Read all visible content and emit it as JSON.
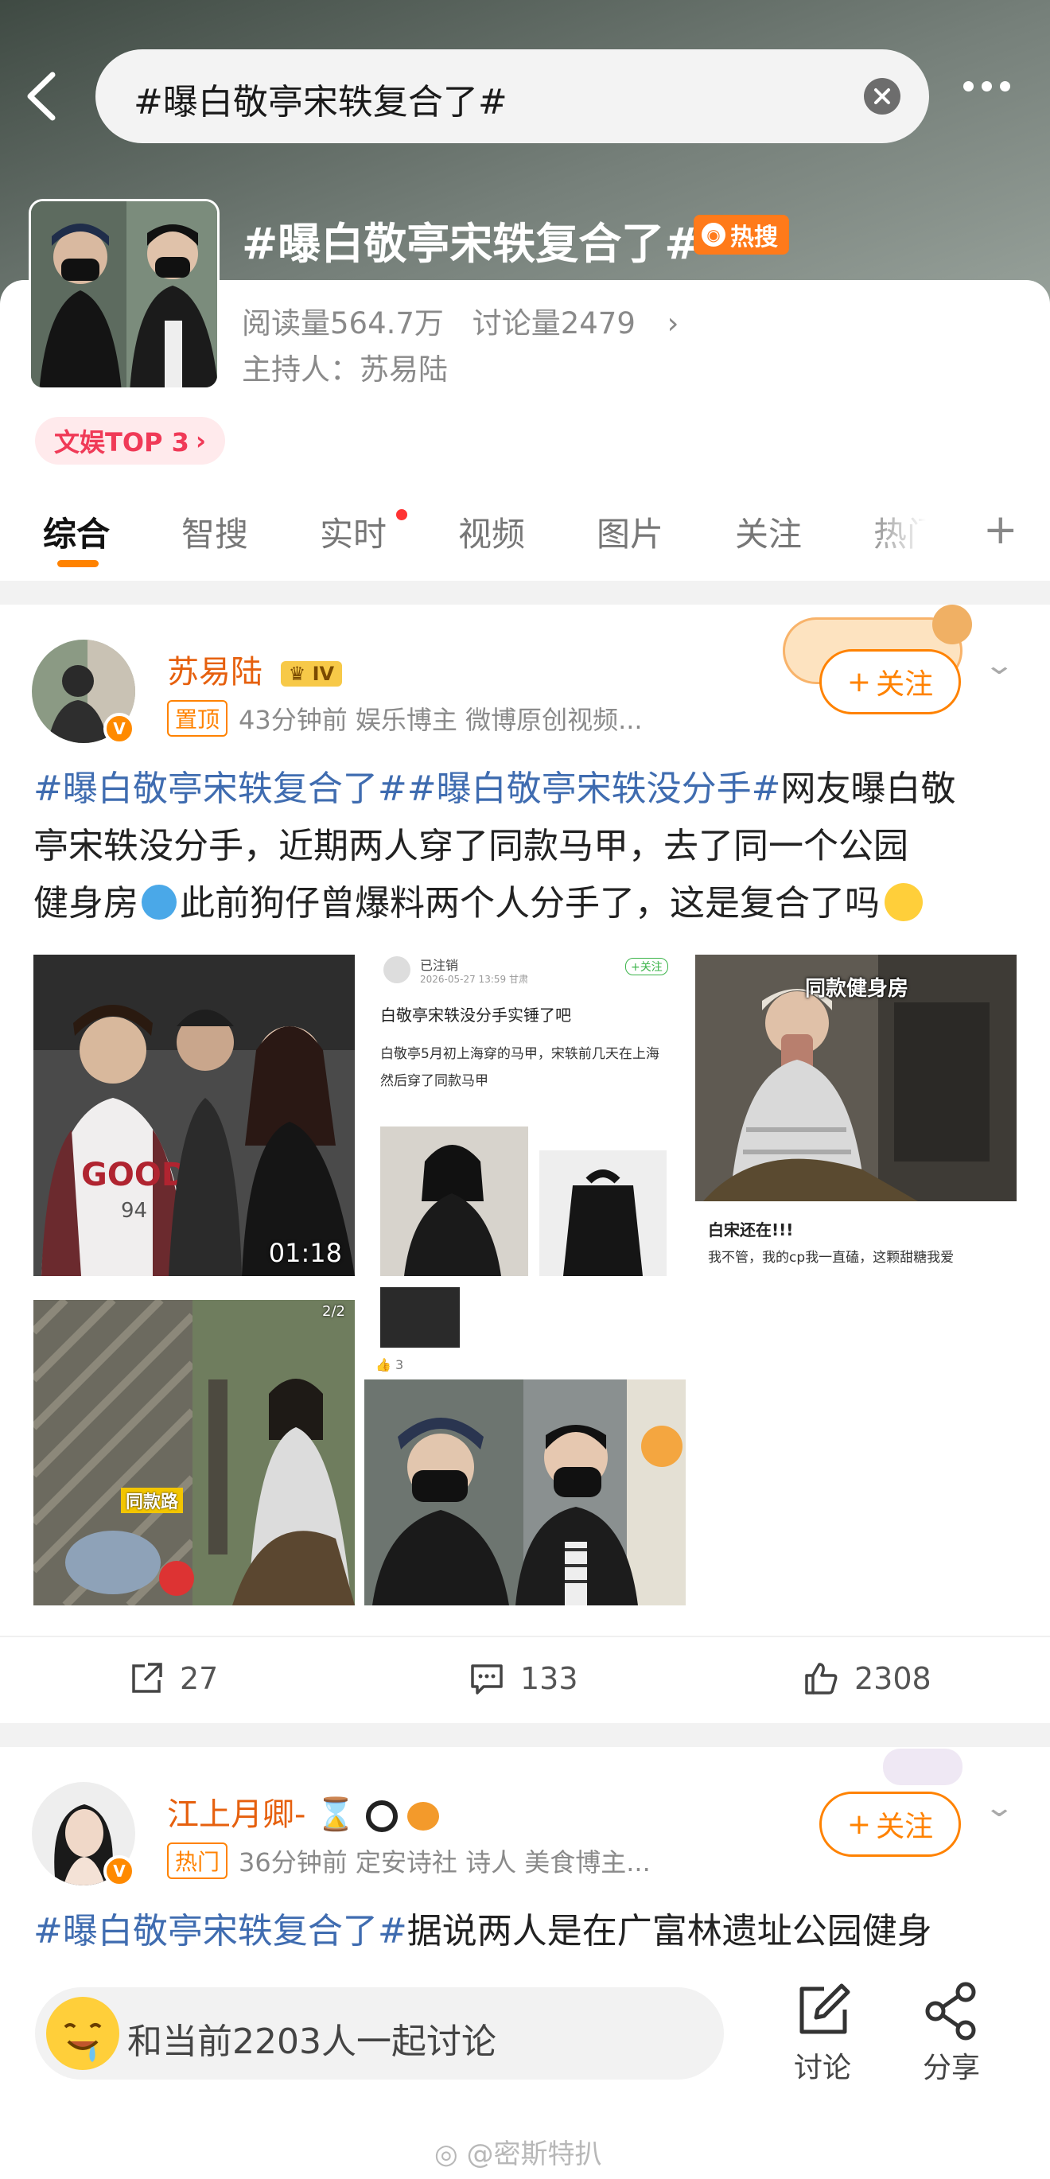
{
  "search": {
    "query": "#曝白敬亭宋轶复合了#"
  },
  "topic": {
    "title": "#曝白敬亭宋轶复合了#",
    "hot_badge": "热搜",
    "read_label": "阅读量564.7万",
    "discuss_label": "讨论量2479",
    "host": "主持人：苏易陆",
    "rank_badge": "文娱TOP 3"
  },
  "tabs": [
    "综合",
    "智搜",
    "实时",
    "视频",
    "图片",
    "关注",
    "热门"
  ],
  "posts": [
    {
      "author": "苏易陆",
      "author_level": "IV",
      "tag": "置顶",
      "meta": "43分钟前  娱乐博主 微博原创视频...",
      "follow": "关注",
      "hashtag1": "#曝白敬亭宋轶复合了#",
      "hashtag2": "#曝白敬亭宋轶没分手#",
      "text1": "网友曝白敬",
      "text2": "亭宋轶没分手，近期两人穿了同款马甲，去了同一个公园",
      "text3": "健身房",
      "text4": "此前狗仔曾爆料两个人分手了，这是复合了吗",
      "video_duration": "01:18",
      "img2": {
        "user": "已注销",
        "date": "2026-05-27 13:59 甘肃",
        "follow": "+关注",
        "title": "白敬亭宋轶没分手实锤了吧",
        "body": "白敬亭5月初上海穿的马甲，宋轶前几天在上海然后穿了同款马甲"
      },
      "img3": {
        "overlay": "同款健身房",
        "caption1": "白宋还在!!!",
        "caption2": "我不管，我的cp我一直磕，这颗甜糖我爱"
      },
      "img4": {
        "count": "2/2",
        "overlay": "同款路"
      },
      "img5": {
        "likes": "3"
      },
      "shares": "27",
      "comments": "133",
      "likes": "2308"
    },
    {
      "author": "江上月卿-",
      "tag": "热门",
      "meta": "36分钟前  定安诗社 诗人 美食博主...",
      "follow": "关注",
      "hashtag1": "#曝白敬亭宋轶复合了#",
      "text1": "据说两人是在广富林遗址公园健身"
    }
  ],
  "bottom": {
    "discuss_text": "和当前2203人一起讨论",
    "discuss_btn": "讨论",
    "share_btn": "分享"
  },
  "watermark": "@密斯特扒",
  "colors": {
    "accent": "#ff8200",
    "hashtag": "#3f6cb0",
    "author": "#e6600e",
    "hot": "#ff7a1a",
    "rank": "#f03a57"
  }
}
